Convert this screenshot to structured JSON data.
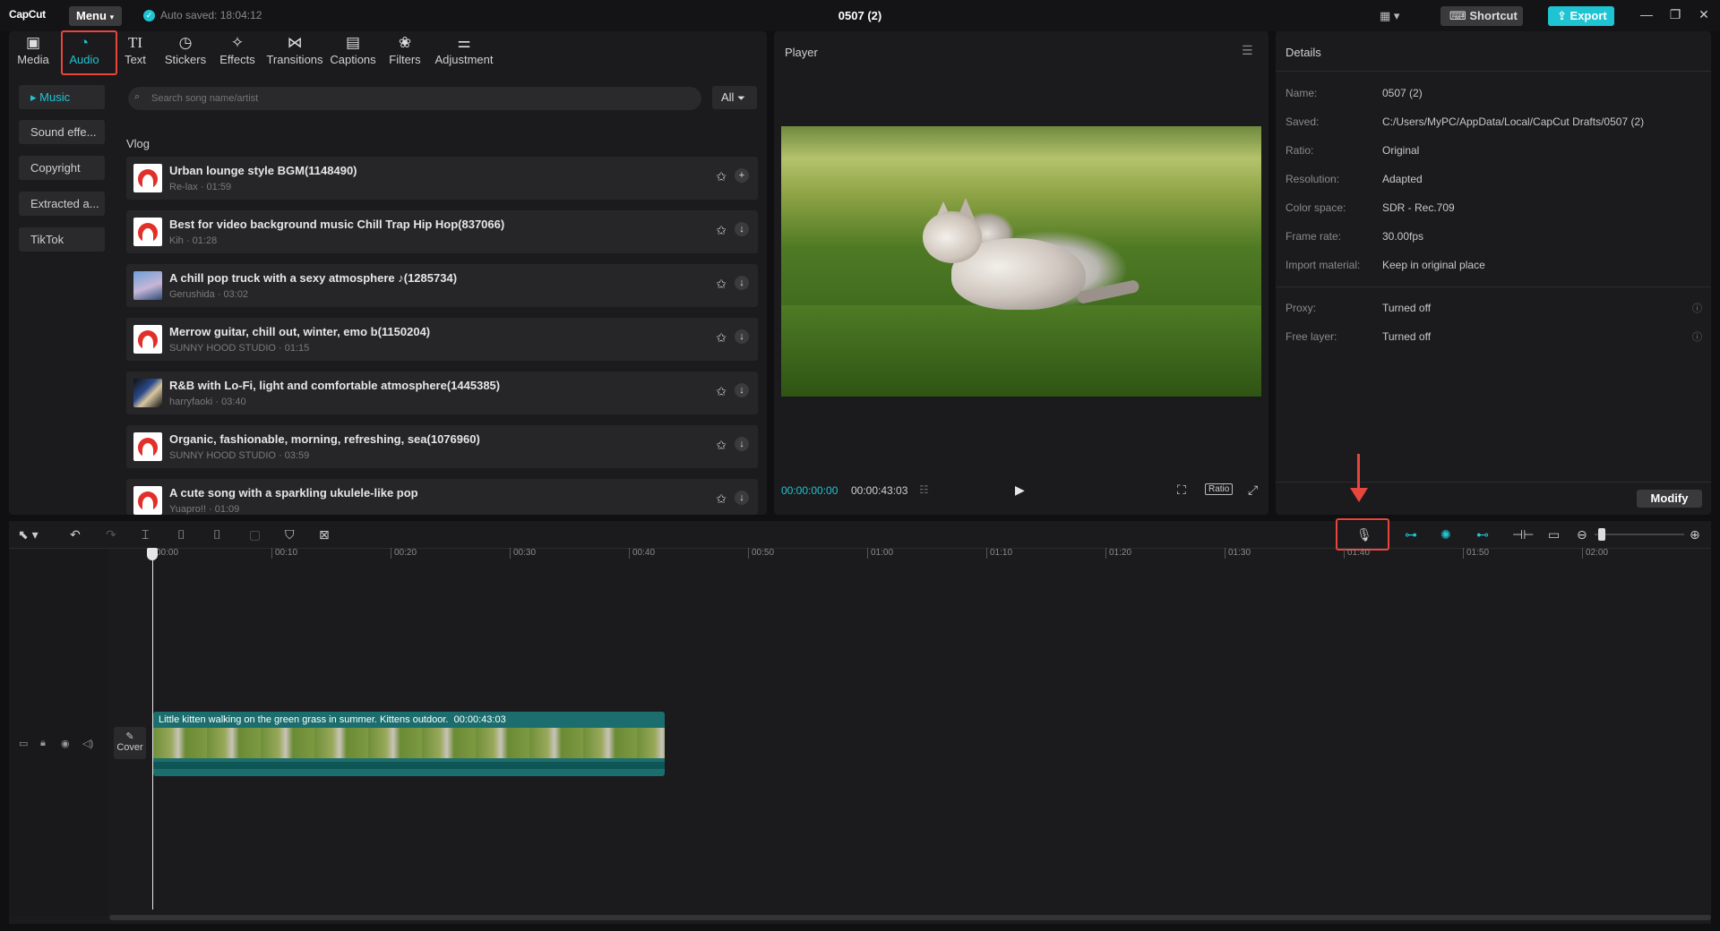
{
  "app": {
    "logo": "CapCut",
    "menu_label": "Menu",
    "autosave": "Auto saved: 18:04:12",
    "project_title": "0507 (2)",
    "shortcut_label": "Shortcut",
    "export_label": "Export"
  },
  "tools": [
    {
      "label": "Media",
      "icon": "media-icon"
    },
    {
      "label": "Audio",
      "icon": "audio-icon",
      "active": true
    },
    {
      "label": "Text",
      "icon": "text-icon"
    },
    {
      "label": "Stickers",
      "icon": "stickers-icon"
    },
    {
      "label": "Effects",
      "icon": "effects-icon"
    },
    {
      "label": "Transitions",
      "icon": "transitions-icon"
    },
    {
      "label": "Captions",
      "icon": "captions-icon"
    },
    {
      "label": "Filters",
      "icon": "filters-icon"
    },
    {
      "label": "Adjustment",
      "icon": "adjustment-icon"
    }
  ],
  "audio_sidebar": [
    "Music",
    "Sound effe...",
    "Copyright",
    "Extracted a...",
    "TikTok"
  ],
  "search": {
    "placeholder": "Search song name/artist",
    "filter_label": "All"
  },
  "section_label": "Vlog",
  "songs": [
    {
      "title": "Urban lounge style BGM(1148490)",
      "sub": "Re-lax · 01:59",
      "action": "add"
    },
    {
      "title": "Best for video background music Chill Trap Hip Hop(837066)",
      "sub": "Kih · 01:28",
      "action": "download"
    },
    {
      "title": "A chill pop truck with a sexy atmosphere ♪(1285734)",
      "sub": "Gerushida · 03:02",
      "action": "download"
    },
    {
      "title": "Merrow guitar, chill out, winter, emo b(1150204)",
      "sub": "SUNNY HOOD STUDIO · 01:15",
      "action": "download"
    },
    {
      "title": "R&B with Lo-Fi, light and comfortable atmosphere(1445385)",
      "sub": "harryfaoki · 03:40",
      "action": "download"
    },
    {
      "title": "Organic, fashionable, morning, refreshing, sea(1076960)",
      "sub": "SUNNY HOOD STUDIO · 03:59",
      "action": "download"
    },
    {
      "title": "A cute song with a sparkling ukulele-like pop",
      "sub": "Yuapro!! · 01:09",
      "action": "download"
    }
  ],
  "player": {
    "title": "Player",
    "current_time": "00:00:00:00",
    "total_time": "00:00:43:03",
    "ratio_label": "Ratio"
  },
  "details": {
    "title": "Details",
    "rows": [
      {
        "label": "Name:",
        "value": "0507 (2)"
      },
      {
        "label": "Saved:",
        "value": "C:/Users/MyPC/AppData/Local/CapCut Drafts/0507 (2)"
      },
      {
        "label": "Ratio:",
        "value": "Original"
      },
      {
        "label": "Resolution:",
        "value": "Adapted"
      },
      {
        "label": "Color space:",
        "value": "SDR - Rec.709"
      },
      {
        "label": "Frame rate:",
        "value": "30.00fps"
      },
      {
        "label": "Import material:",
        "value": "Keep in original place"
      },
      {
        "label": "Proxy:",
        "value": "Turned off"
      },
      {
        "label": "Free layer:",
        "value": "Turned off"
      }
    ],
    "modify_label": "Modify"
  },
  "timeline": {
    "ticks": [
      "00:00",
      "00:10",
      "00:20",
      "00:30",
      "00:40",
      "00:50",
      "01:00",
      "01:10",
      "01:20",
      "01:30",
      "01:40",
      "01:50",
      "02:00"
    ],
    "cover_label": "Cover",
    "clip_label": "Little kitten walking on the green grass in summer. Kittens outdoor.",
    "clip_duration": "00:00:43:03"
  },
  "colors": {
    "accent": "#1fc4d3",
    "highlight": "#e8453c"
  }
}
